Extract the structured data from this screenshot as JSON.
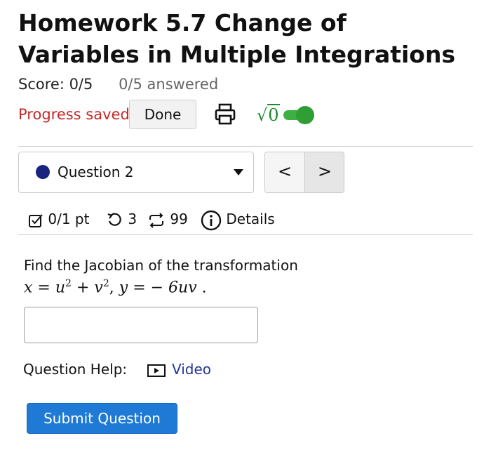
{
  "header": {
    "title": "Homework 5.7 Change of Variables in Multiple Integrations",
    "score": "Score: 0/5",
    "answered": "0/5 answered"
  },
  "toolbar": {
    "progress_status": "Progress saved",
    "done_label": "Done",
    "print_icon": "printer-icon",
    "math_icon_text": "0",
    "math_toggle_on": true,
    "accent_green": "#2e9e35",
    "status_red": "#c62828"
  },
  "question_nav": {
    "selected_question": "Question 2",
    "prev_label": "<",
    "next_label": ">",
    "status_dot_color": "#1a237e"
  },
  "meta": {
    "points": "0/1 pt",
    "retries": "3",
    "attempts": "99",
    "details_label": "Details"
  },
  "question": {
    "prompt": "Find the Jacobian of the transformation",
    "math": {
      "x_var": "x",
      "eq1": "=",
      "u": "u",
      "plus": "+",
      "v": "v",
      "exp": "2",
      "comma": ",",
      "y_var": "y",
      "eq2": "=",
      "rhs": "− 6uv",
      "period": "."
    },
    "answer_value": ""
  },
  "help": {
    "label": "Question Help:",
    "video_label": "Video"
  },
  "submit": {
    "label": "Submit Question",
    "color": "#1f7ad6"
  }
}
